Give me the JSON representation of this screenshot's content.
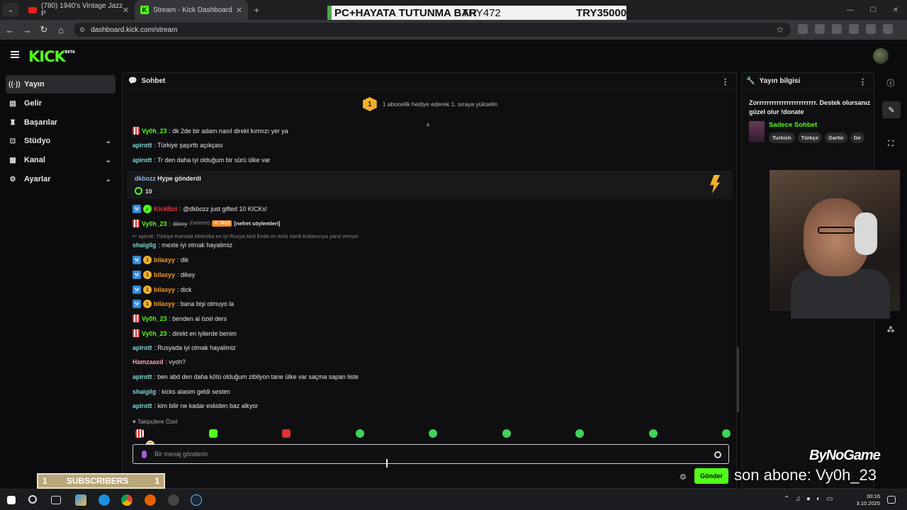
{
  "browser": {
    "tabs": [
      {
        "title": "(780) 1940's Vintage Jazz P",
        "active": false
      },
      {
        "title": "Stream - Kick Dashboard",
        "active": true
      }
    ],
    "url": "dashboard.kick.com/stream"
  },
  "overlay_banner": {
    "left_text": "PC+HAYATA TUTUNMA BAR",
    "mid_text": "TRY472",
    "right_text": "TRY35000"
  },
  "app": {
    "logo": "KICK",
    "logo_badge": "BETA"
  },
  "sidebar": {
    "items": [
      {
        "label": "Yayın",
        "icon": "broadcast-icon",
        "active": true
      },
      {
        "label": "Gelir",
        "icon": "revenue-icon"
      },
      {
        "label": "Başarılar",
        "icon": "trophy-icon"
      },
      {
        "label": "Stüdyo",
        "icon": "studio-icon",
        "expandable": true
      },
      {
        "label": "Kanal",
        "icon": "channel-icon",
        "expandable": true
      },
      {
        "label": "Ayarlar",
        "icon": "gear-icon",
        "expandable": true
      }
    ]
  },
  "chat": {
    "title": "Sohbet",
    "gift_banner": {
      "rank": "1",
      "text": "1 abonelik hediye ederek 1. sıraya yükselin"
    },
    "messages": [
      {
        "user": "Vy0h_23",
        "text": ": dk 2de bir adam nasıl direkt kırmızı yer ya"
      },
      {
        "user": "apirott",
        "text": ": Türkiye şaşırttı açıkçası"
      },
      {
        "user": "apirott",
        "text": ": Tr den daha iyi olduğum bir sürü ülke var"
      },
      {
        "user": "KickBot",
        "text": ": @dkbozz just gifted 10 KICKs!"
      },
      {
        "user": "Vy0h_23",
        "text": "dikey",
        "deleted": "(Deleted)",
        "ai_mod": "AI Mod",
        "reason": "[nefret söylemleri]"
      },
      {
        "user": "shaigilg",
        "text": ": mexte iyi olmak hayalimiz"
      },
      {
        "user": "bilaxyy",
        "text": ": dik"
      },
      {
        "user": "bilaxyy",
        "text": ": dikey"
      },
      {
        "user": "bilaxyy",
        "text": ": dick"
      },
      {
        "user": "bilaxyy",
        "text": ": bana bişi olmuyo la"
      },
      {
        "user": "Vy0h_23",
        "text": ": benden al özel ders"
      },
      {
        "user": "Vy0h_23",
        "text": ": direkt en iyilerde benim"
      },
      {
        "user": "apirott",
        "text": ": Rusyada iyi olmak hayalimiz"
      },
      {
        "user": "Hamzaaxd",
        "text": ": vyoh?"
      },
      {
        "user": "apirott",
        "text": ": ben abd den daha kötü olduğum zibilyon tane ülke var saçma sapan liste"
      },
      {
        "user": "shaigilg",
        "text": ": kicks alasim geldi sesten"
      },
      {
        "user": "apirott",
        "text": ": kim bilir ne kadar eskiden baz alkyor"
      }
    ],
    "hype": {
      "user": "dkbozz",
      "text": "Hype gönderdi",
      "amount": "10"
    },
    "reply_context": "apirott: Türkiye Kanada Meksika en iyi Rusya Abd Endo en kötü isimli kullanıcıya yanıt veriyor",
    "follower_only": "Takipçilere Özel",
    "input_placeholder": "Bir mesaj gönderin",
    "send_label": "Gönder"
  },
  "stream_info": {
    "title": "Yayın bilgisi",
    "stream_title": "Zorrrrrrrrrrrrrrrrrrrrrrrr. Destek olursanız güzel olur !donate",
    "category": "Sadece Sohbet",
    "tags": [
      "Turkish",
      "Türkçe",
      "Gartic",
      "Ge"
    ]
  },
  "overlays": {
    "subs_bar": {
      "left": "1",
      "label": "SUBSCRIBERS",
      "right": "1"
    },
    "sponsor": "ByNoGame",
    "last_sub": "son abone: Vy0h_23"
  },
  "taskbar": {
    "time": "00:16",
    "date": "3.10.2025"
  }
}
